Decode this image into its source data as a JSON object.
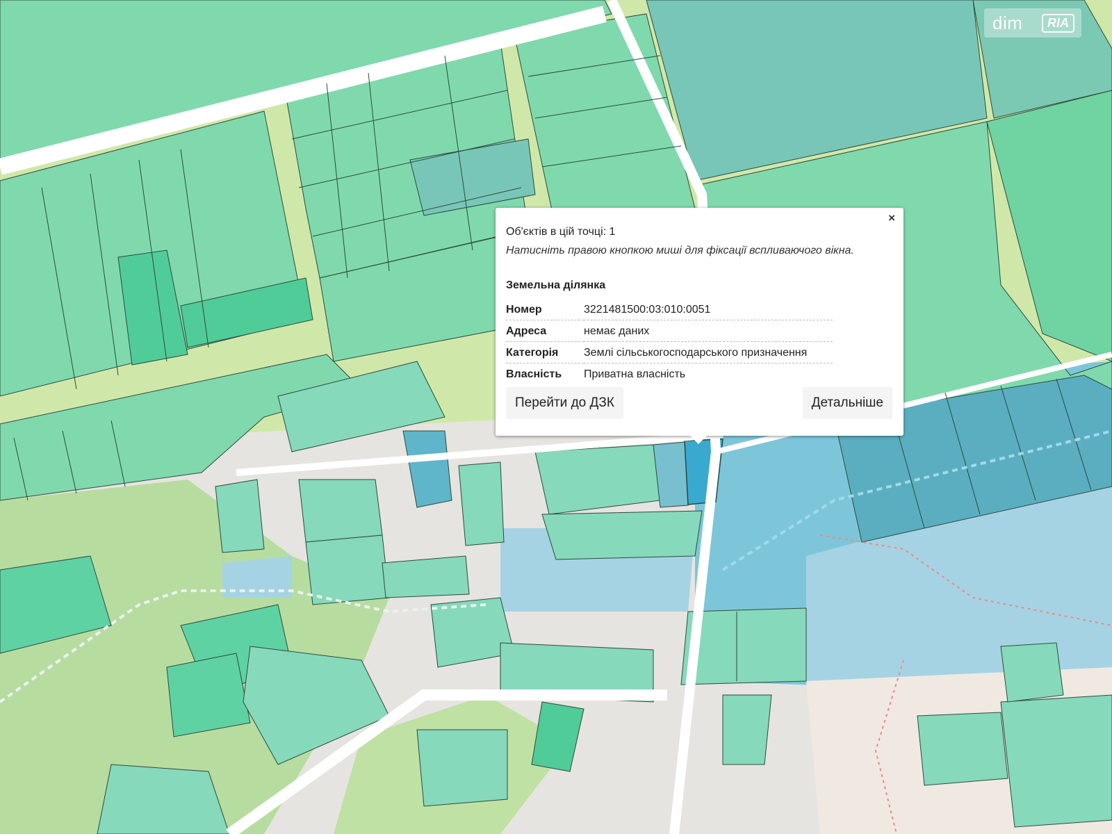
{
  "watermark": {
    "part1": "dim",
    "part2": "RIA"
  },
  "popup": {
    "close": "×",
    "objects_count": "Об'єктів в цій точці: 1",
    "hint": "Натисніть правою кнопкою миші для фіксації вспливаючого вікна.",
    "object_type": "Земельна ділянка",
    "attributes": [
      {
        "key": "Номер",
        "value": "3221481500:03:010:0051"
      },
      {
        "key": "Адреса",
        "value": "немає даних"
      },
      {
        "key": "Категорія",
        "value": "Землі сільськогосподарського призначення"
      },
      {
        "key": "Власність",
        "value": "Приватна власність"
      }
    ],
    "buttons": {
      "goto": "Перейти до ДЗК",
      "details": "Детальніше"
    }
  },
  "colors": {
    "parcel_green": "#7fd9ad",
    "parcel_teal": "#78c6b8",
    "highlight_blue": "#3aa9cf",
    "water": "#a6d3e3",
    "road": "#ffffff",
    "field_light": "#cfe8a9"
  }
}
